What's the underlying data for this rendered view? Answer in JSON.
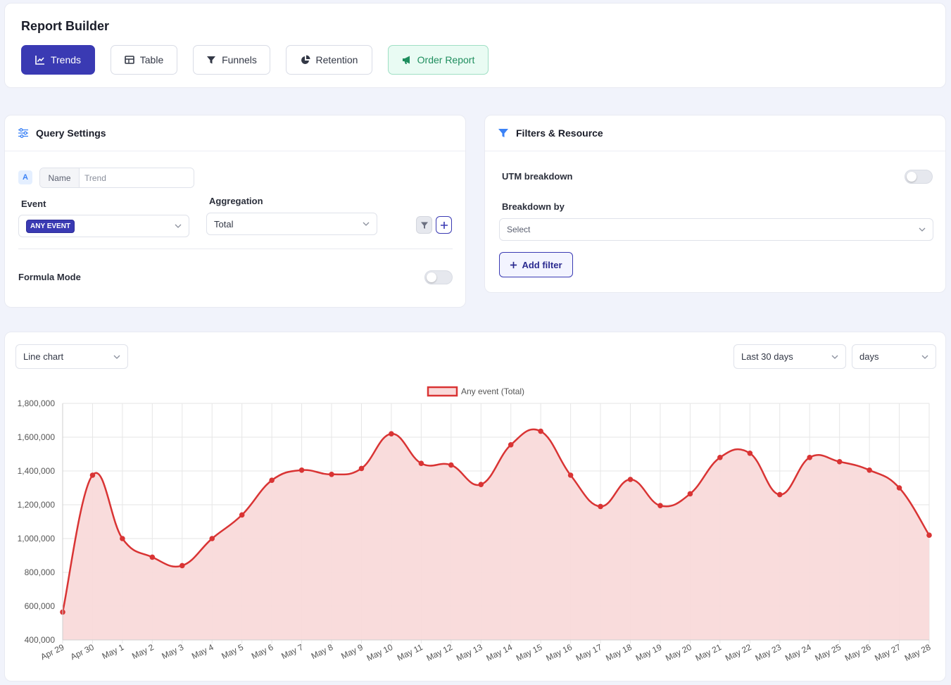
{
  "header": {
    "title": "Report Builder",
    "tabs": [
      {
        "label": "Trends",
        "icon": "line-chart-icon",
        "active": true
      },
      {
        "label": "Table",
        "icon": "table-icon",
        "active": false
      },
      {
        "label": "Funnels",
        "icon": "funnel-icon",
        "active": false
      },
      {
        "label": "Retention",
        "icon": "pie-chart-icon",
        "active": false
      },
      {
        "label": "Order Report",
        "icon": "megaphone-icon",
        "active": false
      }
    ]
  },
  "query": {
    "title": "Query Settings",
    "series_badge": "A",
    "name_label": "Name",
    "name_placeholder": "Trend",
    "event_label": "Event",
    "event_value": "ANY EVENT",
    "aggregation_label": "Aggregation",
    "aggregation_value": "Total",
    "formula_label": "Formula Mode",
    "formula_on": false
  },
  "filters": {
    "title": "Filters & Resource",
    "utm_label": "UTM breakdown",
    "utm_on": false,
    "breakdown_label": "Breakdown by",
    "breakdown_placeholder": "Select",
    "add_filter_label": "Add filter"
  },
  "chart_controls": {
    "chart_type": "Line chart",
    "range": "Last 30 days",
    "interval": "days"
  },
  "colors": {
    "accent": "#3a3ab3",
    "series_line": "#d93434",
    "series_fill": "#f9dada",
    "order_green": "#1f8e5e"
  },
  "chart_data": {
    "type": "area",
    "legend": "Any event (Total)",
    "legend_position": "top-center",
    "grid": true,
    "ylim": [
      400000,
      1800000
    ],
    "y_ticks": [
      "400,000",
      "600,000",
      "800,000",
      "1,000,000",
      "1,200,000",
      "1,400,000",
      "1,600,000",
      "1,800,000"
    ],
    "categories": [
      "Apr 29",
      "Apr 30",
      "May 1",
      "May 2",
      "May 3",
      "May 4",
      "May 5",
      "May 6",
      "May 7",
      "May 8",
      "May 9",
      "May 10",
      "May 11",
      "May 12",
      "May 13",
      "May 14",
      "May 15",
      "May 16",
      "May 17",
      "May 18",
      "May 19",
      "May 20",
      "May 21",
      "May 22",
      "May 23",
      "May 24",
      "May 25",
      "May 26",
      "May 27",
      "May 28"
    ],
    "series": [
      {
        "name": "Any event (Total)",
        "values": [
          565000,
          1375000,
          1000000,
          890000,
          840000,
          1000000,
          1140000,
          1345000,
          1405000,
          1380000,
          1415000,
          1620000,
          1445000,
          1435000,
          1320000,
          1555000,
          1635000,
          1375000,
          1190000,
          1350000,
          1195000,
          1265000,
          1480000,
          1505000,
          1260000,
          1480000,
          1455000,
          1405000,
          1300000,
          1020000
        ]
      }
    ]
  }
}
